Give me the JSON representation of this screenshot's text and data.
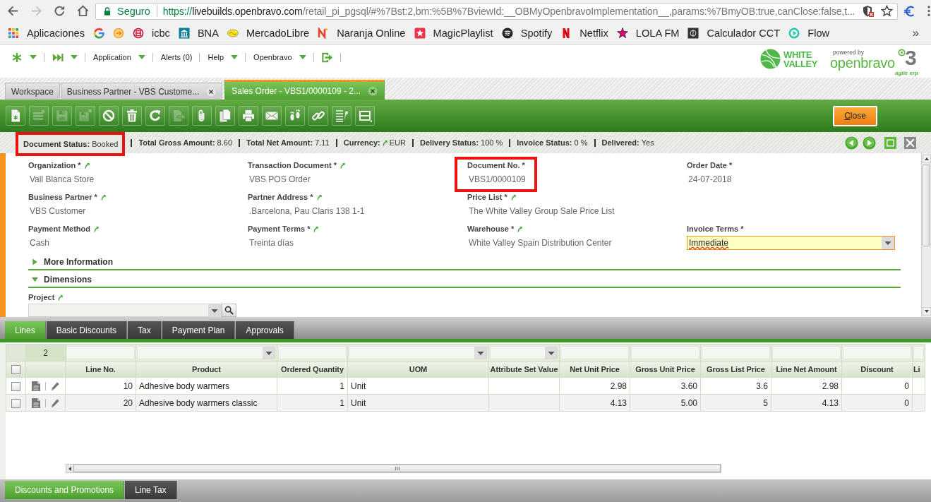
{
  "browser": {
    "nav_buttons": [
      {
        "kind": "back",
        "disabled": false
      },
      {
        "kind": "forward",
        "disabled": true
      },
      {
        "kind": "reload",
        "disabled": false
      },
      {
        "kind": "home",
        "disabled": false
      }
    ],
    "address": {
      "security": "Seguro",
      "url_scheme": "https://",
      "url_host": "livebuilds.openbravo.com",
      "url_path": "/retail_pi_pgsql/#%7Bst:2,bm:%5B%7BviewId:__OBMyOpenbravoImplementation__,params:%7BmyOB:true,canClose:false,t..."
    },
    "bookmarks": [
      {
        "kind": "apps",
        "label": "Aplicaciones"
      },
      {
        "kind": "ring"
      },
      {
        "kind": "circle-arrows"
      },
      {
        "kind": "coin",
        "label": "icbc"
      },
      {
        "kind": "bank",
        "label": "BNA"
      },
      {
        "kind": "handshake",
        "label": "MercadoLibre"
      },
      {
        "kind": "zigzag",
        "label": "Naranja Online"
      },
      {
        "kind": "star-tile",
        "label": "MagicPlaylist"
      },
      {
        "kind": "waves",
        "label": "Spotify"
      },
      {
        "kind": "stripes",
        "label": "Netflix"
      },
      {
        "kind": "star",
        "label": "LOLA FM"
      },
      {
        "kind": "tile",
        "label": "Calculador CCT"
      },
      {
        "kind": "play",
        "label": "Flow"
      }
    ],
    "bookmarks_overflow": "»"
  },
  "app_menu": [
    {
      "kind": "asterisk",
      "dropdown": true
    },
    {
      "kind": "skip",
      "dropdown": true
    },
    {
      "kind": "text",
      "label": "Application",
      "dropdown": true
    },
    {
      "kind": "text",
      "label": "Alerts (0)",
      "dropdown": false
    },
    {
      "kind": "text",
      "label": "Help",
      "dropdown": true
    },
    {
      "kind": "text",
      "label": "Openbravo",
      "dropdown": true
    },
    {
      "kind": "logout",
      "dropdown": false
    }
  ],
  "logos": {
    "client": {
      "line_1": "WHITE",
      "line_2": "VALLEY"
    },
    "vendor": {
      "tagline": "powered by",
      "name": "openbravo",
      "version": "3",
      "subtitle": "agile erp"
    }
  },
  "window_tabs": [
    {
      "label": "Workspace",
      "selected": false,
      "closable": false
    },
    {
      "label": "Business Partner - VBS Custome...",
      "selected": false,
      "closable": true
    },
    {
      "label": "Sales Order - VBS1/0000109 - 2...",
      "selected": true,
      "closable": true
    }
  ],
  "toolbar": {
    "buttons": [
      {
        "kind": "new",
        "disabled": false
      },
      {
        "kind": "new-row",
        "disabled": true
      },
      {
        "kind": "save",
        "disabled": true
      },
      {
        "kind": "save-close",
        "disabled": true
      },
      {
        "kind": "cancel",
        "disabled": false
      },
      {
        "kind": "delete",
        "disabled": false
      },
      {
        "kind": "refresh",
        "disabled": false
      },
      {
        "kind": "export",
        "disabled": true
      },
      {
        "kind": "attach",
        "disabled": false
      },
      {
        "kind": "copy",
        "disabled": false
      },
      {
        "kind": "print",
        "disabled": false
      },
      {
        "kind": "email",
        "disabled": false
      },
      {
        "kind": "audit",
        "disabled": false
      },
      {
        "kind": "link",
        "disabled": false
      },
      {
        "kind": "tools",
        "disabled": false
      },
      {
        "kind": "layout",
        "disabled": false
      }
    ],
    "close_label": "Close"
  },
  "status_bar": {
    "items": [
      {
        "label": "Document Status:",
        "value": "Booked",
        "link": false,
        "highlighted": true
      },
      {
        "label": "Total Gross Amount:",
        "value": "8.60",
        "link": false,
        "highlighted": false
      },
      {
        "label": "Total Net Amount:",
        "value": "7.11",
        "link": false,
        "highlighted": false
      },
      {
        "label": "Currency:",
        "value": "EUR",
        "link": true,
        "highlighted": false
      },
      {
        "label": "Delivery Status:",
        "value": "100 %",
        "link": false,
        "highlighted": false
      },
      {
        "label": "Invoice Status:",
        "value": "0 %",
        "link": false,
        "highlighted": false
      },
      {
        "label": "Delivered:",
        "value": "Yes",
        "link": false,
        "highlighted": false
      }
    ],
    "controls": [
      {
        "kind": "previous"
      },
      {
        "kind": "next"
      },
      {
        "kind": "maximize"
      },
      {
        "kind": "close"
      }
    ]
  },
  "form": {
    "rows": [
      [
        {
          "kind": "display",
          "label": "Organization *",
          "value": "Vall Blanca Store",
          "link": true,
          "highlighted": false
        },
        {
          "kind": "display",
          "label": "Transaction Document *",
          "value": "VBS POS Order",
          "link": true,
          "highlighted": false
        },
        {
          "kind": "display",
          "label": "Document No. *",
          "value": "VBS1/0000109",
          "link": false,
          "highlighted": true
        },
        {
          "kind": "display",
          "label": "Order Date *",
          "value": "24-07-2018",
          "link": false,
          "highlighted": false
        }
      ],
      [
        {
          "kind": "display",
          "label": "Business Partner *",
          "value": "VBS Customer",
          "link": true,
          "highlighted": false
        },
        {
          "kind": "display",
          "label": "Partner Address *",
          "value": ".Barcelona, Pau Claris 138 1-1",
          "link": true,
          "highlighted": false
        },
        {
          "kind": "display",
          "label": "Price List *",
          "value": "The White Valley Group Sale Price List",
          "link": true,
          "highlighted": false
        }
      ],
      [
        {
          "kind": "display",
          "label": "Payment Method",
          "value": "Cash",
          "link": true,
          "highlighted": false
        },
        {
          "kind": "display",
          "label": "Payment Terms *",
          "value": "Treinta días",
          "link": true,
          "highlighted": false
        },
        {
          "kind": "display",
          "label": "Warehouse *",
          "value": "White Valley Spain Distribution Center",
          "link": true,
          "highlighted": false
        },
        {
          "kind": "combo",
          "label": "Invoice Terms *",
          "value": "Immediate",
          "link": false,
          "highlighted": false,
          "focused": true,
          "misspelled": true
        }
      ]
    ],
    "sections": [
      {
        "label": "More Information",
        "expanded": false
      },
      {
        "label": "Dimensions",
        "expanded": true,
        "fields": [
          {
            "kind": "combo-search",
            "label": "Project",
            "link": true,
            "focused": false
          }
        ]
      }
    ]
  },
  "sub_tabs": [
    {
      "label": "Lines",
      "selected": true
    },
    {
      "label": "Basic Discounts",
      "selected": false
    },
    {
      "label": "Tax",
      "selected": false
    },
    {
      "label": "Payment Plan",
      "selected": false
    },
    {
      "label": "Approvals",
      "selected": false
    }
  ],
  "grid": {
    "row_count": "2",
    "select_all": {
      "checked": false
    },
    "columns": [
      {
        "label": "Line No.",
        "kind": "number",
        "filter_dropdown": false
      },
      {
        "label": "Product",
        "kind": "text",
        "filter_dropdown": true
      },
      {
        "label": "Ordered Quantity",
        "kind": "number",
        "filter_dropdown": false
      },
      {
        "label": "UOM",
        "kind": "text",
        "filter_dropdown": true
      },
      {
        "label": "Attribute Set Value",
        "kind": "text",
        "filter_dropdown": true
      },
      {
        "label": "Net Unit Price",
        "kind": "number",
        "filter_dropdown": false
      },
      {
        "label": "Gross Unit Price",
        "kind": "number",
        "filter_dropdown": false
      },
      {
        "label": "Gross List Price",
        "kind": "number",
        "filter_dropdown": false
      },
      {
        "label": "Line Net Amount",
        "kind": "number",
        "filter_dropdown": false
      },
      {
        "label": "Discount",
        "kind": "number",
        "filter_dropdown": false
      },
      {
        "label": "Li",
        "kind": "text",
        "filter_dropdown": false
      }
    ],
    "rows": [
      {
        "checked": false,
        "cells": [
          "10",
          "Adhesive body warmers",
          "1",
          "Unit",
          null,
          "2.98",
          "3.60",
          "3.6",
          "2.98",
          "0",
          null
        ]
      },
      {
        "checked": false,
        "cells": [
          "20",
          "Adhesive body warmers classic",
          "1",
          "Unit",
          null,
          "4.13",
          "5.00",
          "5",
          "4.13",
          "0",
          null
        ]
      }
    ]
  },
  "bottom_tabs": [
    {
      "label": "Discounts and Promotions",
      "selected": true
    },
    {
      "label": "Line Tax",
      "selected": false
    }
  ]
}
